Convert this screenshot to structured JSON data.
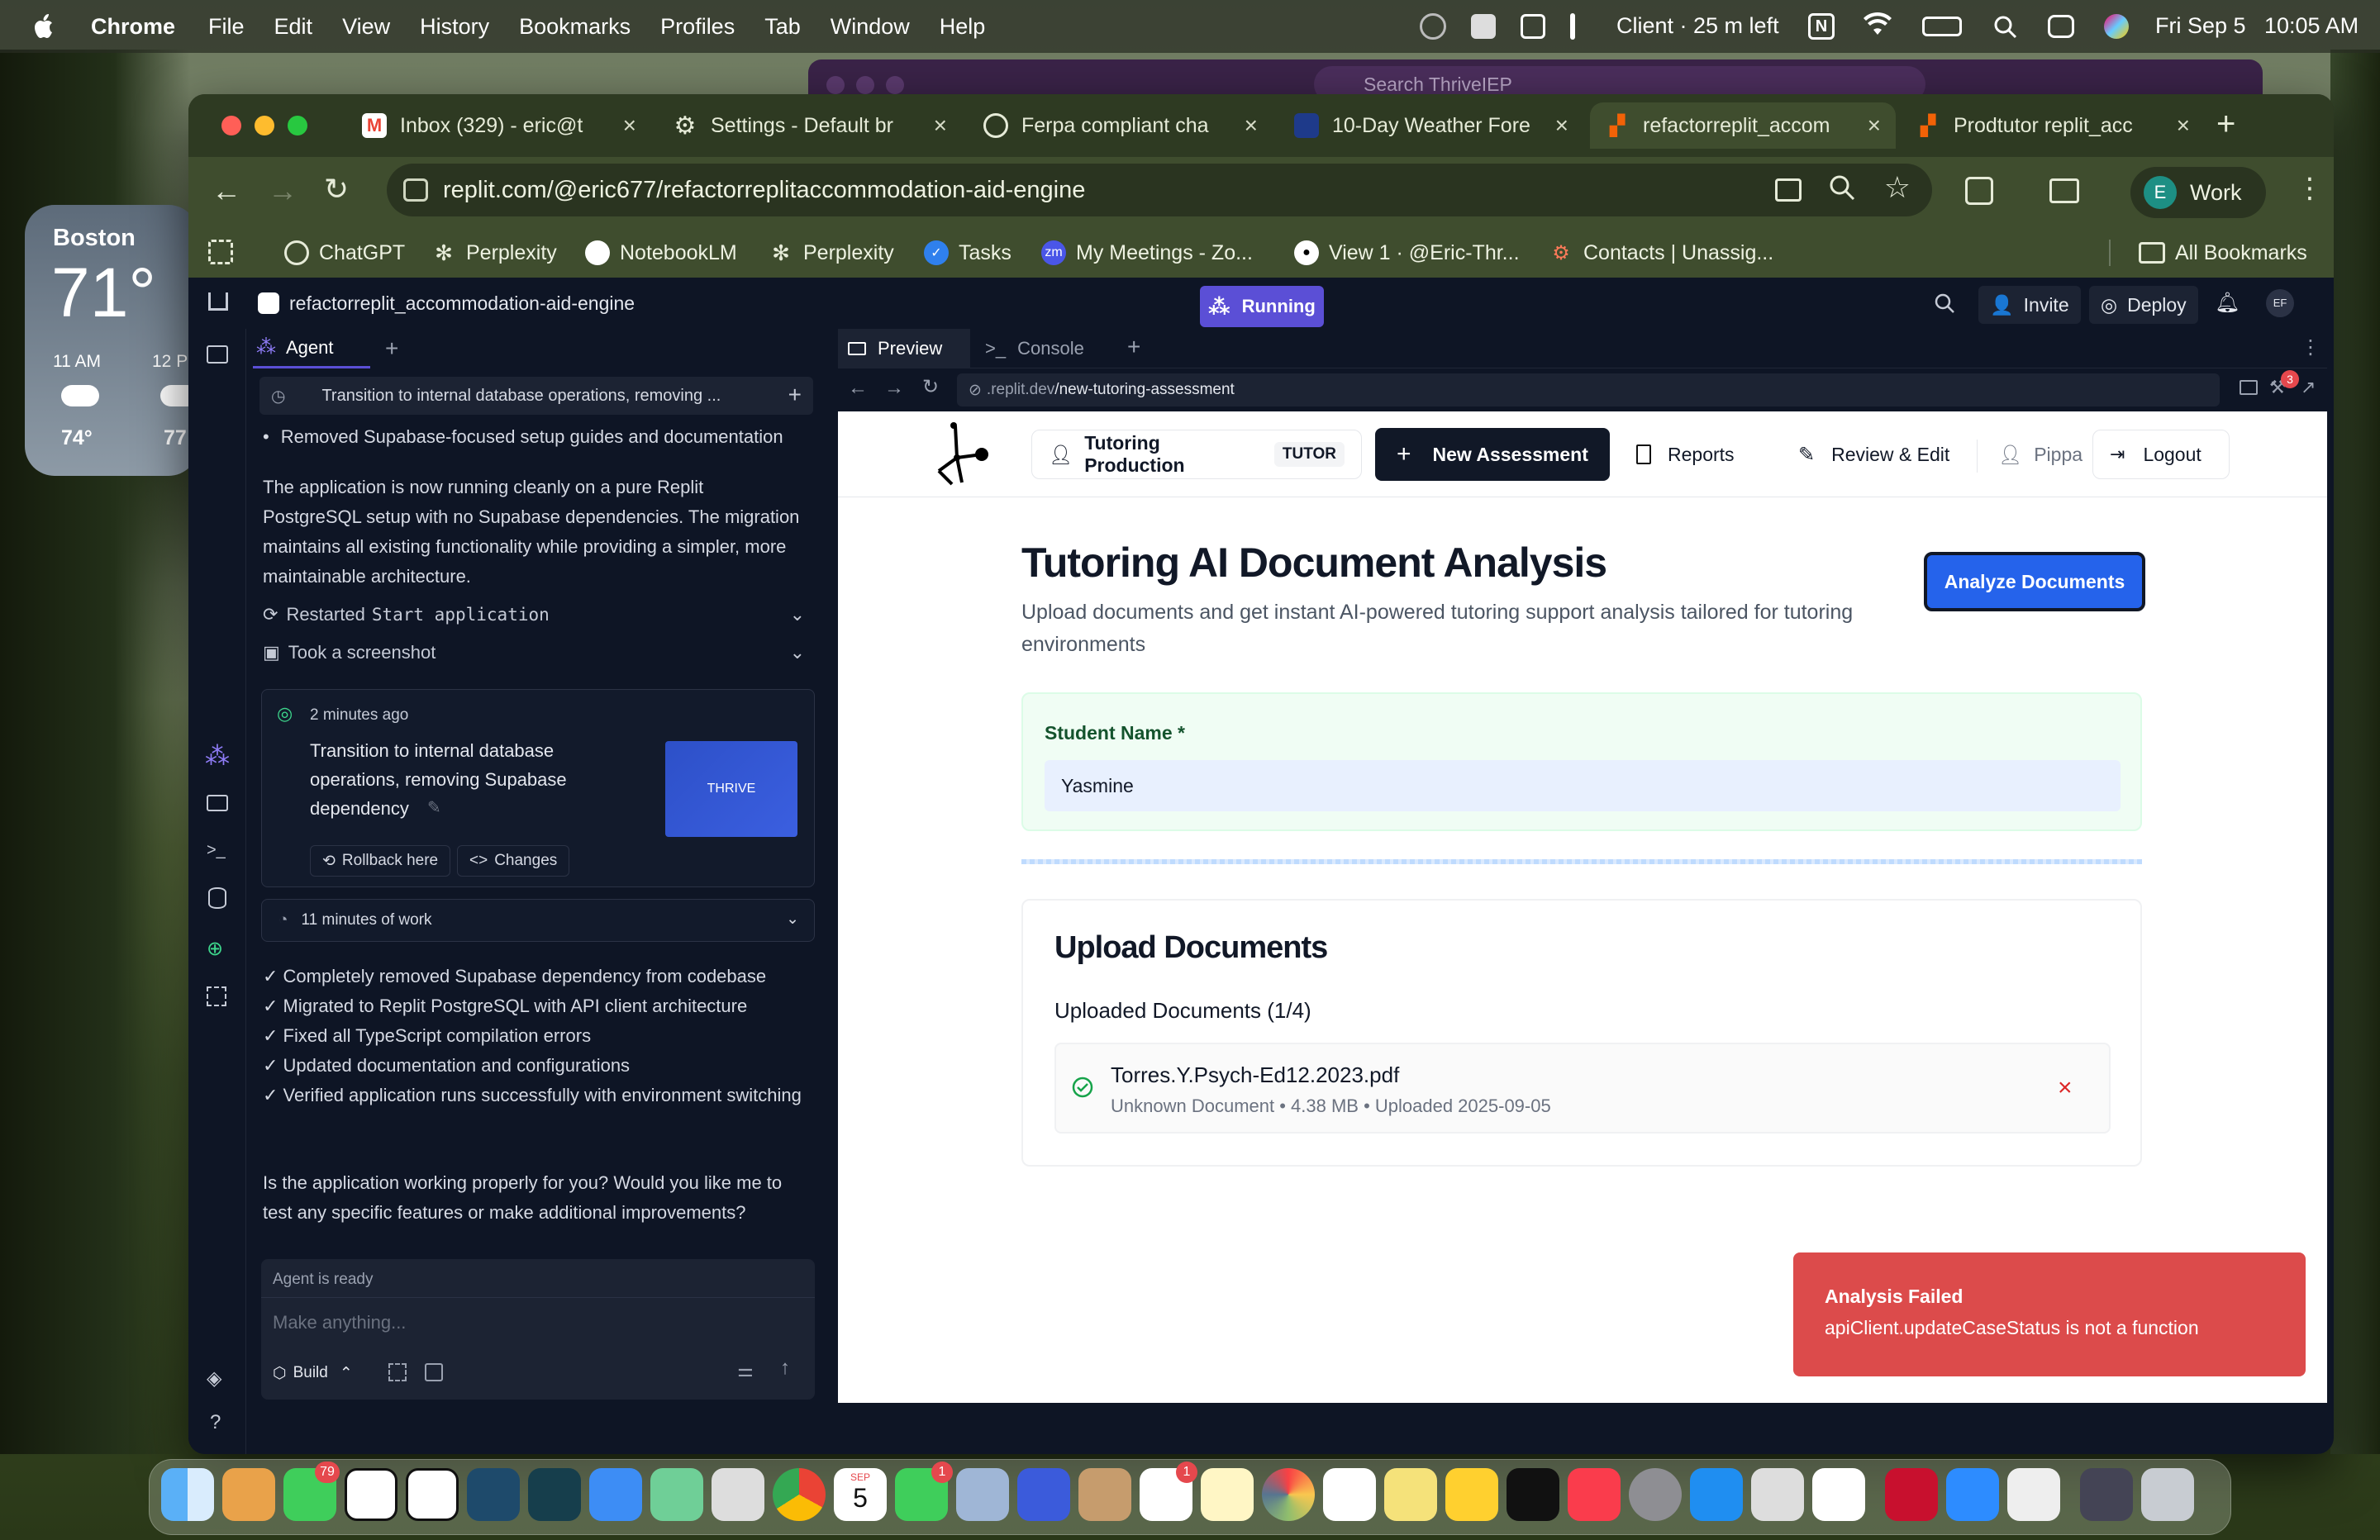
{
  "menubar": {
    "app": "Chrome",
    "items": [
      "File",
      "Edit",
      "View",
      "History",
      "Bookmarks",
      "Profiles",
      "Tab",
      "Window",
      "Help"
    ],
    "status": "Client · 25 m left",
    "date": "Fri Sep 5",
    "time": "10:05 AM"
  },
  "weather": {
    "city": "Boston",
    "temp": "71°",
    "hour1": "11 AM",
    "hour1_temp": "74°",
    "hour2": "12 P",
    "hour2_temp": "77"
  },
  "background_window": {
    "search_placeholder": "Search ThriveIEP"
  },
  "browser": {
    "tabs": [
      {
        "title": "Inbox (329) - eric@t",
        "icon": "gmail-icon"
      },
      {
        "title": "Settings - Default br",
        "icon": "settings-icon"
      },
      {
        "title": "Ferpa compliant cha",
        "icon": "chatgpt-icon"
      },
      {
        "title": "10-Day Weather Fore",
        "icon": "weather-channel-icon"
      },
      {
        "title": "refactorreplit_accom",
        "icon": "replit-icon",
        "active": true
      },
      {
        "title": "Prodtutor replit_acc",
        "icon": "replit-icon"
      }
    ],
    "url": "replit.com/@eric677/refactorreplitaccommodation-aid-engine",
    "profile_initial": "E",
    "profile_label": "Work",
    "bookmarks": [
      {
        "label": "ChatGPT",
        "icon": "chatgpt-icon"
      },
      {
        "label": "Perplexity",
        "icon": "perplexity-icon"
      },
      {
        "label": "NotebookLM",
        "icon": "notebooklm-icon"
      },
      {
        "label": "Perplexity",
        "icon": "perplexity-icon"
      },
      {
        "label": "Tasks",
        "icon": "tasks-icon"
      },
      {
        "label": "My Meetings - Zo...",
        "icon": "zoom-icon"
      },
      {
        "label": "View 1 · @Eric-Thr...",
        "icon": "github-icon"
      },
      {
        "label": "Contacts | Unassig...",
        "icon": "hubspot-icon"
      }
    ],
    "all_bookmarks": "All Bookmarks"
  },
  "replit": {
    "project": "refactorreplit_accommodation-aid-engine",
    "status": "Running",
    "invite": "Invite",
    "deploy": "Deploy",
    "avatar": "EF",
    "agent_tab": "Agent",
    "thread_title": "Transition to internal database operations, removing ...",
    "bullet": "Removed Supabase-focused setup guides and documentation",
    "summary": "The application is now running cleanly on a pure Replit PostgreSQL setup with no Supabase dependencies. The migration maintains all existing functionality while providing a simpler, more maintainable architecture.",
    "action1_prefix": "Restarted",
    "action1_code": "Start application",
    "action2": "Took a screenshot",
    "checkpoint_time": "2 minutes ago",
    "checkpoint_text": "Transition to internal database operations, removing Supabase dependency",
    "thumb_text": "THRIVE",
    "rollback": "Rollback here",
    "changes": "Changes",
    "work_time": "11 minutes of work",
    "checklist": [
      "✓ Completely removed Supabase dependency from codebase",
      "✓ Migrated to Replit PostgreSQL with API client architecture",
      "✓ Fixed all TypeScript compilation errors",
      "✓ Updated documentation and configurations",
      "✓ Verified application runs successfully with environment switching"
    ],
    "question": "Is the application working properly for you? Would you like me to test any specific features or make additional improvements?",
    "agent_status": "Agent is ready",
    "input_placeholder": "Make anything...",
    "build": "Build",
    "preview_tab": "Preview",
    "console_tab": "Console",
    "preview_url_host": ".replit.dev",
    "preview_url_path": "/new-tutoring-assessment",
    "notif_count": "3"
  },
  "app": {
    "env_label": "Tutoring Production",
    "env_badge": "TUTOR",
    "new_assessment": "New Assessment",
    "reports": "Reports",
    "review_edit": "Review & Edit",
    "user": "Pippa",
    "logout": "Logout",
    "title": "Tutoring AI Document Analysis",
    "subtitle": "Upload documents and get instant AI-powered tutoring support analysis tailored for tutoring environments",
    "analyze_button": "Analyze Documents",
    "student_label": "Student Name *",
    "student_value": "Yasmine",
    "upload_heading": "Upload Documents",
    "uploaded_heading": "Uploaded Documents (1/4)",
    "file_name": "Torres.Y.Psych-Ed12.2023.pdf",
    "file_meta": "Unknown Document • 4.38 MB • Uploaded 2025-09-05",
    "toast_title": "Analysis Failed",
    "toast_message": "apiClient.updateCaseStatus is not a function"
  },
  "dock": {
    "messages_badge": "79",
    "calendar_month": "SEP",
    "calendar_day": "5",
    "facetime_badge": "1",
    "reminders_badge": "1"
  },
  "colors": {
    "replit_bg": "#0e1525",
    "accent_blue": "#2563eb",
    "toast_red": "#dc4b4b",
    "running_purple": "#5b4fd6"
  }
}
